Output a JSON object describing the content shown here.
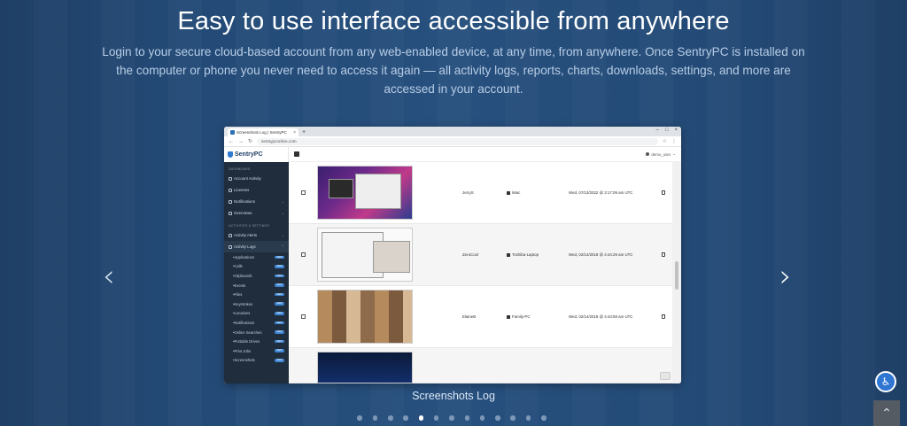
{
  "hero": {
    "headline": "Easy to use interface accessible from anywhere",
    "subtext": "Login to your secure cloud-based account from any web-enabled device, at any time, from anywhere.  Once SentryPC is installed on the computer or phone you never need to access it again — all activity logs, reports, charts, downloads, settings, and more are accessed in your account."
  },
  "browser": {
    "tab_title": "Screenshots Log | SentryPC",
    "url": "sentrypconline.com",
    "user": "demo_user"
  },
  "app": {
    "brand": "SentryPC",
    "sections": [
      "DASHBOARD",
      "ACTIVITIES & SETTINGS"
    ],
    "nav_top": [
      {
        "label": "Account Activity"
      },
      {
        "label": "Licenses"
      },
      {
        "label": "Notifications"
      },
      {
        "label": "Overviews"
      }
    ],
    "nav_mid": [
      {
        "label": "Activity Alerts"
      },
      {
        "label": "Activity Logs"
      }
    ],
    "sub_items": [
      {
        "label": "Applications",
        "badge": "NEW"
      },
      {
        "label": "Calls",
        "badge": "NEW"
      },
      {
        "label": "Clipboards",
        "badge": "NEW"
      },
      {
        "label": "Events",
        "badge": "NEW"
      },
      {
        "label": "Files",
        "badge": "NEW"
      },
      {
        "label": "Keystrokes",
        "badge": "NEW"
      },
      {
        "label": "Locations",
        "badge": "NEW"
      },
      {
        "label": "Notifications",
        "badge": "NEW"
      },
      {
        "label": "Online Searches",
        "badge": "NEW"
      },
      {
        "label": "Portable Drives",
        "badge": "NEW"
      },
      {
        "label": "Print Jobs",
        "badge": "NEW"
      },
      {
        "label": "Screenshots",
        "badge": "NEW"
      }
    ],
    "rows": [
      {
        "user": "JerryS",
        "computer": "iMac",
        "date": "Wed, 07/13/2022 @ 3:17:09 am UTC"
      },
      {
        "user": "ZeroCool",
        "computer": "Toshiba-Laptop",
        "date": "Wed, 02/14/2018 @ 4:44:29 am UTC"
      },
      {
        "user": "ElaineB",
        "computer": "Family-PC",
        "date": "Wed, 02/14/2018 @ 4:43:59 am UTC"
      }
    ]
  },
  "caption": "Screenshots Log",
  "carousel": {
    "total": 13,
    "active": 5
  },
  "icons": {
    "prev": "chevron-left-icon",
    "next": "chevron-right-icon",
    "accessibility": "accessibility-icon",
    "back_to_top": "chevron-up-icon"
  }
}
